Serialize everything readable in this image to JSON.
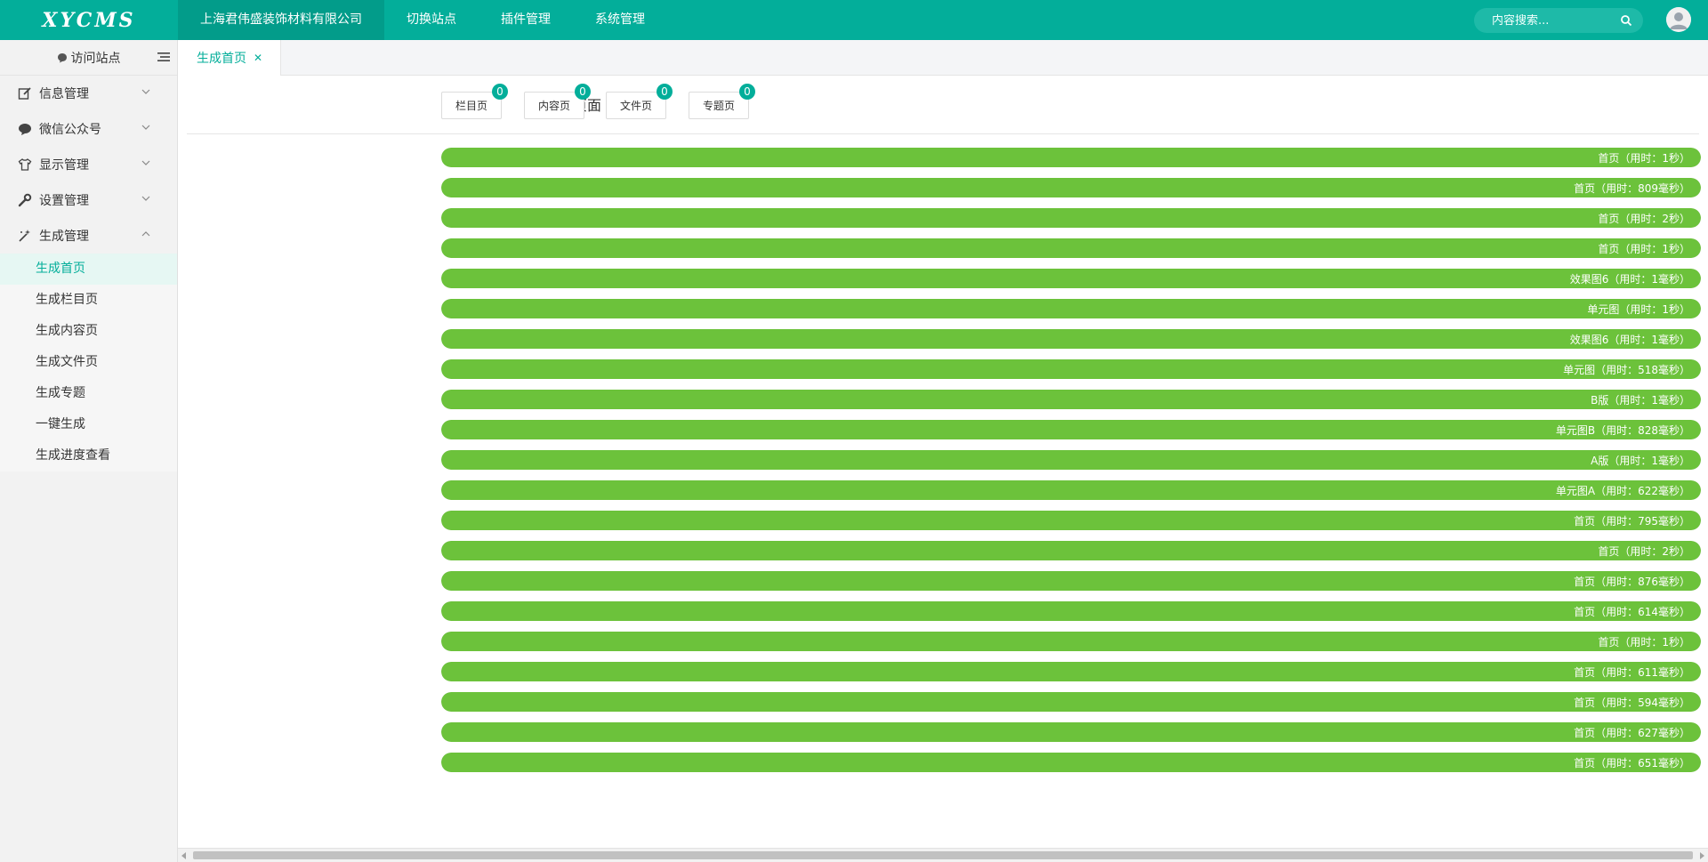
{
  "app": {
    "logo": "XYCMS",
    "top_nav": [
      {
        "label": "上海君伟盛装饰材料有限公司"
      },
      {
        "label": "切换站点"
      },
      {
        "label": "插件管理"
      },
      {
        "label": "系统管理"
      }
    ],
    "search": {
      "placeholder": "内容搜索..."
    }
  },
  "sidebar": {
    "visit_label": "访问站点",
    "groups": [
      {
        "label": "信息管理",
        "icon": "edit-icon"
      },
      {
        "label": "微信公众号",
        "icon": "chat-icon"
      },
      {
        "label": "显示管理",
        "icon": "shirt-icon"
      },
      {
        "label": "设置管理",
        "icon": "wrench-icon"
      },
      {
        "label": "生成管理",
        "icon": "magic-wand-icon",
        "expanded": true
      }
    ],
    "sub_items": [
      {
        "label": "生成首页",
        "active": true
      },
      {
        "label": "生成栏目页"
      },
      {
        "label": "生成内容页"
      },
      {
        "label": "生成文件页"
      },
      {
        "label": "生成专题"
      },
      {
        "label": "一键生成"
      },
      {
        "label": "生成进度查看"
      }
    ]
  },
  "tabs": [
    {
      "label": "生成首页",
      "close": "✕"
    }
  ],
  "main": {
    "remaining_label": "剩余页面",
    "counters": [
      {
        "label": "栏目页",
        "count": "0"
      },
      {
        "label": "内容页",
        "count": "0"
      },
      {
        "label": "文件页",
        "count": "0"
      },
      {
        "label": "专题页",
        "count": "0"
      }
    ],
    "progress_rows": [
      {
        "type": "栏目页",
        "text": "首页（用时：1秒）",
        "progress": 1.0
      },
      {
        "type": "栏目页",
        "text": "首页（用时：809毫秒）",
        "progress": 1.0
      },
      {
        "type": "栏目页",
        "text": "首页（用时：2秒）",
        "progress": 1.0
      },
      {
        "type": "栏目页",
        "text": "首页（用时：1秒）",
        "progress": 1.0
      },
      {
        "type": "栏目页",
        "text": "效果图6（用时：1毫秒）",
        "progress": 1.0
      },
      {
        "type": "内容页",
        "text": "单元图（用时：1秒）",
        "progress": 1.0
      },
      {
        "type": "栏目页",
        "text": "效果图6（用时：1毫秒）",
        "progress": 1.0
      },
      {
        "type": "内容页",
        "text": "单元图（用时：518毫秒）",
        "progress": 1.0
      },
      {
        "type": "栏目页",
        "text": "B版（用时：1毫秒）",
        "progress": 1.0
      },
      {
        "type": "内容页",
        "text": "单元图B（用时：828毫秒）",
        "progress": 1.0
      },
      {
        "type": "栏目页",
        "text": "A版（用时：1毫秒）",
        "progress": 1.0
      },
      {
        "type": "内容页",
        "text": "单元图A（用时：622毫秒）",
        "progress": 1.0
      },
      {
        "type": "栏目页",
        "text": "首页（用时：795毫秒）",
        "progress": 1.0
      },
      {
        "type": "栏目页",
        "text": "首页（用时：2秒）",
        "progress": 1.0
      },
      {
        "type": "栏目页",
        "text": "首页（用时：876毫秒）",
        "progress": 1.0
      },
      {
        "type": "栏目页",
        "text": "首页（用时：614毫秒）",
        "progress": 1.0
      },
      {
        "type": "栏目页",
        "text": "首页（用时：1秒）",
        "progress": 1.0
      },
      {
        "type": "栏目页",
        "text": "首页（用时：611毫秒）",
        "progress": 1.0
      },
      {
        "type": "栏目页",
        "text": "首页（用时：594毫秒）",
        "progress": 1.0
      },
      {
        "type": "栏目页",
        "text": "首页（用时：627毫秒）",
        "progress": 1.0
      },
      {
        "type": "栏目页",
        "text": "首页（用时：651毫秒）",
        "progress": 1.0
      }
    ]
  },
  "colors": {
    "primary": "#03ae9a",
    "progress": "#6cc23b"
  }
}
